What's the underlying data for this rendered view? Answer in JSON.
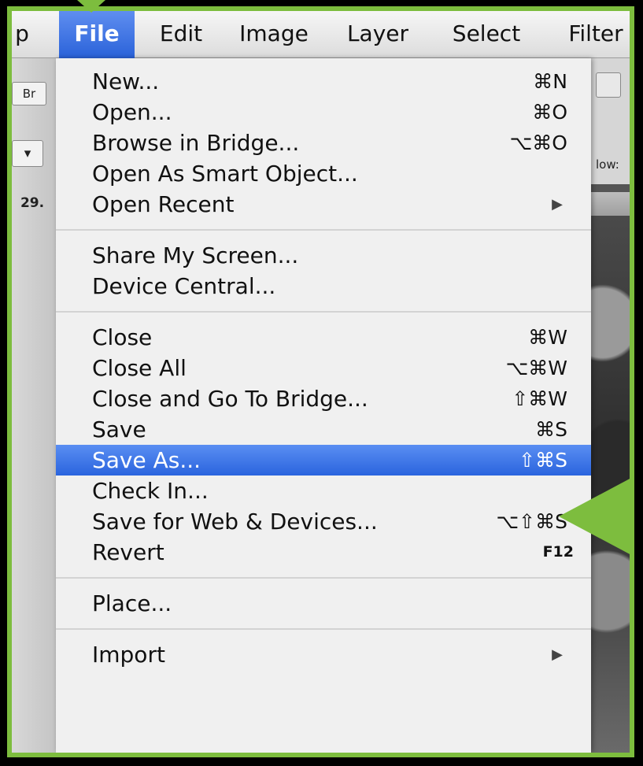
{
  "menubar": {
    "items": [
      "p",
      "File",
      "Edit",
      "Image",
      "Layer",
      "Select",
      "Filter"
    ],
    "active": "File"
  },
  "background": {
    "left_controls": [
      "Br",
      "▾",
      "29."
    ],
    "right_label": "low:"
  },
  "file_menu": {
    "groups": [
      [
        {
          "label": "New...",
          "shortcut": "⌘N"
        },
        {
          "label": "Open...",
          "shortcut": "⌘O"
        },
        {
          "label": "Browse in Bridge...",
          "shortcut": "⌥⌘O"
        },
        {
          "label": "Open As Smart Object...",
          "shortcut": ""
        },
        {
          "label": "Open Recent",
          "shortcut": "",
          "submenu": true
        }
      ],
      [
        {
          "label": "Share My Screen...",
          "shortcut": ""
        },
        {
          "label": "Device Central...",
          "shortcut": ""
        }
      ],
      [
        {
          "label": "Close",
          "shortcut": "⌘W"
        },
        {
          "label": "Close All",
          "shortcut": "⌥⌘W"
        },
        {
          "label": "Close and Go To Bridge...",
          "shortcut": "⇧⌘W"
        },
        {
          "label": "Save",
          "shortcut": "⌘S"
        },
        {
          "label": "Save As...",
          "shortcut": "⇧⌘S",
          "highlighted": true
        },
        {
          "label": "Check In...",
          "shortcut": ""
        },
        {
          "label": "Save for Web & Devices...",
          "shortcut": "⌥⇧⌘S"
        },
        {
          "label": "Revert",
          "shortcut": "F12"
        }
      ],
      [
        {
          "label": "Place...",
          "shortcut": ""
        }
      ],
      [
        {
          "label": "Import",
          "shortcut": "",
          "submenu": true
        }
      ]
    ]
  },
  "colors": {
    "frame": "#7dbd3e",
    "highlight": "#3a72e4"
  }
}
